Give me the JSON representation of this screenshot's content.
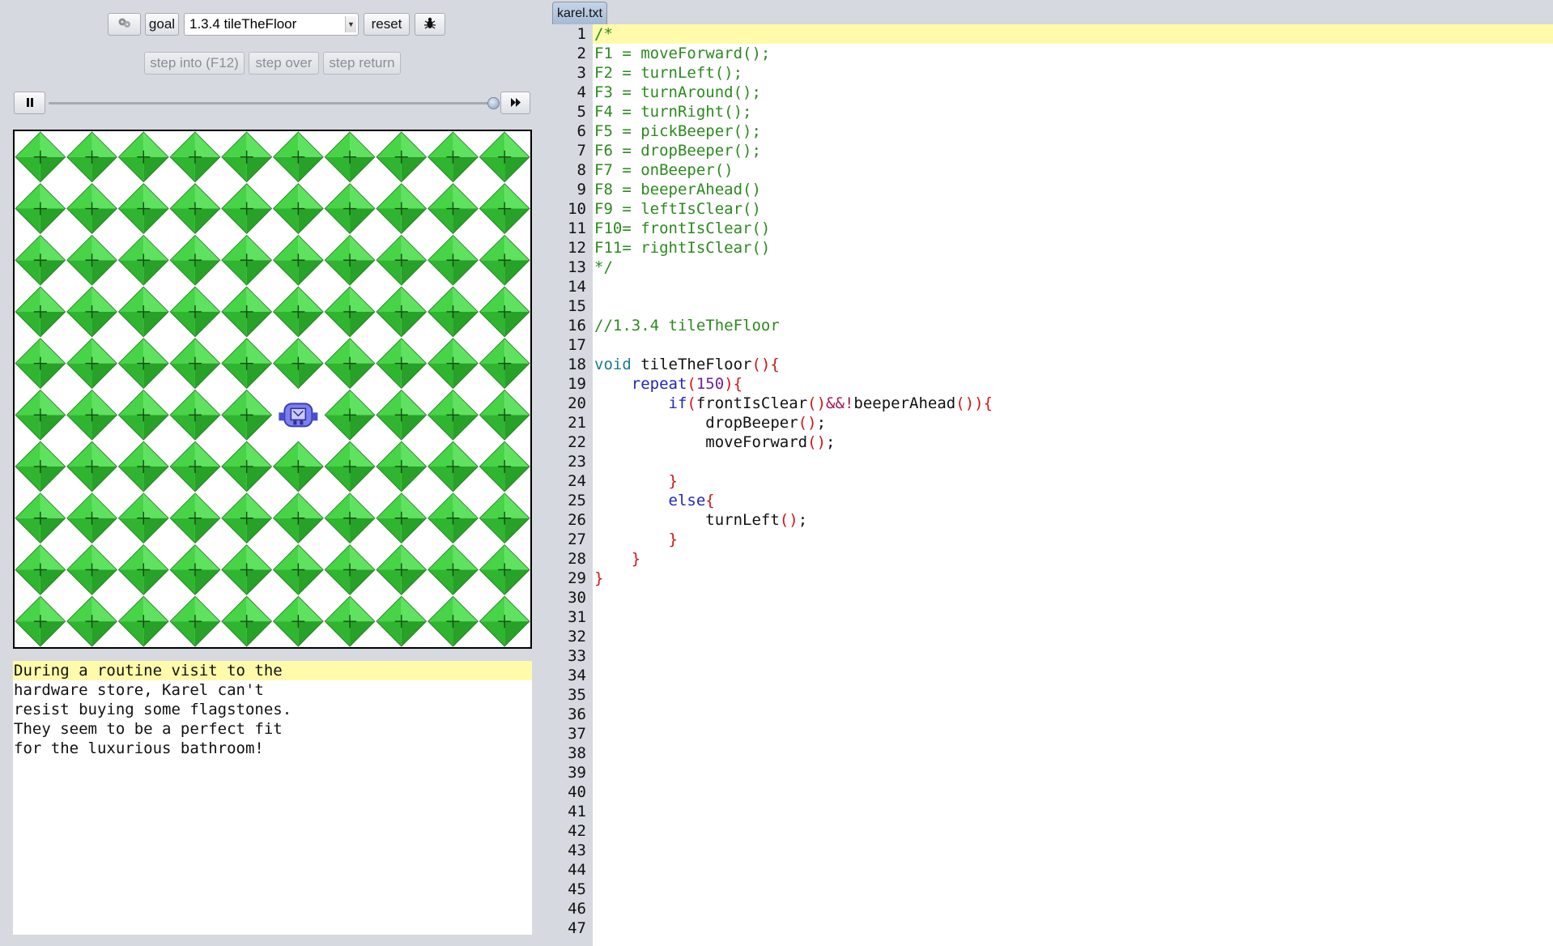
{
  "toolbar": {
    "goal_label": "goal",
    "level_value": "1.3.4 tileTheFloor",
    "reset_label": "reset",
    "step_into_label": "step into (F12)",
    "step_over_label": "step over",
    "step_return_label": "step return",
    "pause_icon": "pause-icon",
    "fast_forward_icon": "fast-forward-icon",
    "bug_icon": "bug-icon",
    "settings_icon": "gears-icon"
  },
  "speed_slider": {
    "value": 1.0
  },
  "world": {
    "columns": 10,
    "rows": 10,
    "beeper_color": "#2fc22f",
    "karel": {
      "column": 5,
      "row": 5
    }
  },
  "story": {
    "lines": [
      "During a routine visit to the",
      "hardware store, Karel can't",
      "resist buying some flagstones.",
      "They seem to be a perfect fit",
      "for the luxurious bathroom!"
    ]
  },
  "editor": {
    "tab_label": "karel.txt",
    "line_count": 47,
    "lines": [
      "/*",
      "F1 = moveForward();",
      "F2 = turnLeft();",
      "F3 = turnAround();",
      "F4 = turnRight();",
      "F5 = pickBeeper();",
      "F6 = dropBeeper();",
      "F7 = onBeeper()",
      "F8 = beeperAhead()",
      "F9 = leftIsClear()",
      "F10= frontIsClear()",
      "F11= rightIsClear()",
      "*/",
      "",
      "",
      "//1.3.4 tileTheFloor",
      "",
      "void tileTheFloor(){",
      "    repeat(150){",
      "        if(frontIsClear()&&!beeperAhead()){",
      "            dropBeeper();",
      "            moveForward();",
      "",
      "        }",
      "        else{",
      "            turnLeft();",
      "        }",
      "    }",
      "}"
    ]
  }
}
